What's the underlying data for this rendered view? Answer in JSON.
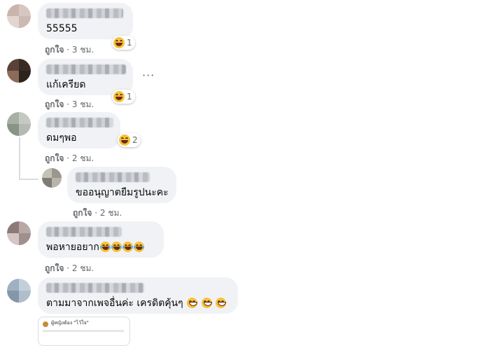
{
  "comments": [
    {
      "text": "55555",
      "like_label": "ถูกใจ",
      "time": "3 ชม.",
      "reaction_count": "1"
    },
    {
      "text": "แก้เครียด",
      "like_label": "ถูกใจ",
      "time": "3 ชม.",
      "reaction_count": "1"
    },
    {
      "text": "ดมๆพอ",
      "like_label": "ถูกใจ",
      "time": "2 ชม.",
      "reaction_count": "2"
    },
    {
      "text": "ขออนุญาตยืมรูปนะคะ",
      "like_label": "ถูกใจ",
      "time": "2 ชม."
    },
    {
      "text": "พอหายอยาก",
      "like_label": "ถูกใจ",
      "time": "2 ชม."
    },
    {
      "text": "ตามมาจากเพจอื่นค่ะ เครดิตคุ้นๆ"
    }
  ],
  "separator": "·",
  "more_options": "···",
  "preview_caption": "ผู้หญิงต้อง \"ไว้ใจ\"",
  "colors": {
    "bubble": "#f0f2f5",
    "meta": "#65676b",
    "reaction": "#f7c23a"
  }
}
